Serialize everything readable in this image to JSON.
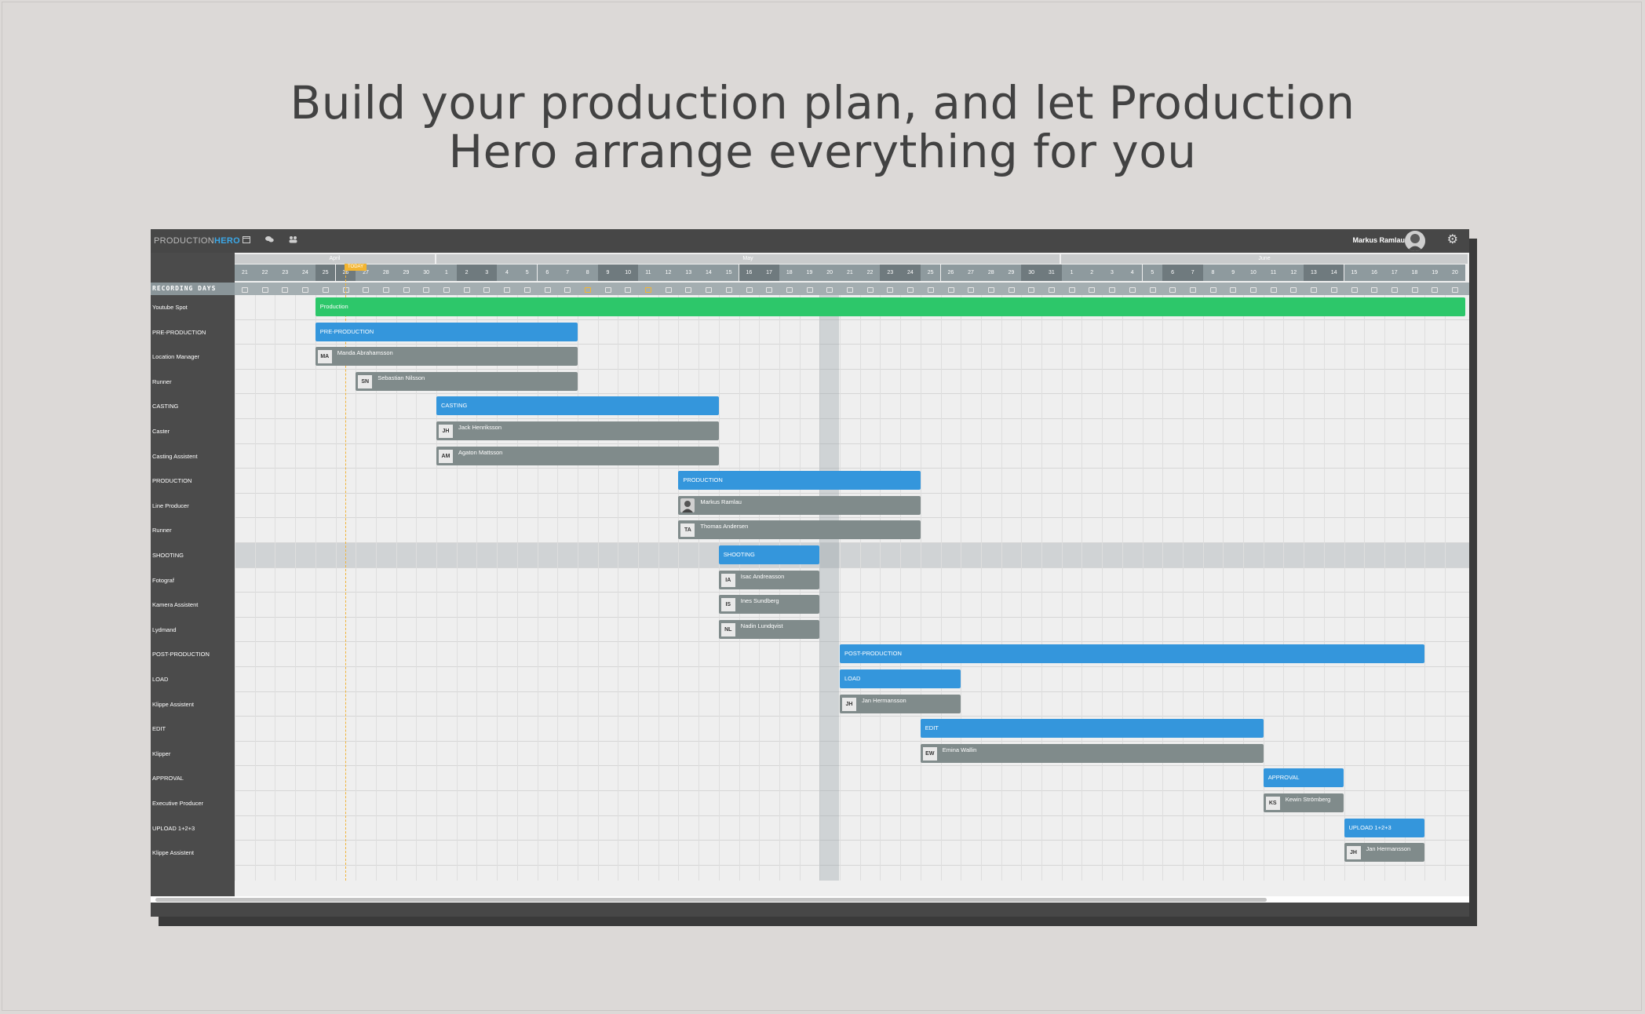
{
  "headline": {
    "line1": "Build your production plan, and let Production",
    "line2": "Hero arrange everything for you"
  },
  "app": {
    "logo_prefix": "PRODUCTION",
    "logo_suffix": "HERO",
    "toolbar_icons": [
      "calendar-icon",
      "chat-icon",
      "team-icon"
    ],
    "user_name": "Markus Ramlau",
    "accent_color": "#3ba8e8"
  },
  "calendar": {
    "months": [
      "April",
      "May",
      "June"
    ],
    "days": [
      "21",
      "22",
      "23",
      "24",
      "25",
      "26",
      "27",
      "28",
      "29",
      "30",
      "1",
      "2",
      "3",
      "4",
      "5",
      "6",
      "7",
      "8",
      "9",
      "10",
      "11",
      "12",
      "13",
      "14",
      "15",
      "16",
      "17",
      "18",
      "19",
      "20",
      "21",
      "22",
      "23",
      "24",
      "25",
      "26",
      "27",
      "28",
      "29",
      "30",
      "31",
      "1",
      "2",
      "3",
      "4",
      "5",
      "6",
      "7",
      "8",
      "9",
      "10",
      "11",
      "12",
      "13",
      "14",
      "15",
      "16",
      "17",
      "18",
      "19",
      "20"
    ],
    "today_label": "TODAY",
    "recording_days_label": "RECORDING DAYS"
  },
  "rows": [
    {
      "label": "Youtube Spot"
    },
    {
      "label": "PRE-PRODUCTION"
    },
    {
      "label": "Location Manager"
    },
    {
      "label": "Runner"
    },
    {
      "label": "CASTING"
    },
    {
      "label": "Caster"
    },
    {
      "label": "Casting Assistent"
    },
    {
      "label": "PRODUCTION"
    },
    {
      "label": "Line Producer"
    },
    {
      "label": "Runner"
    },
    {
      "label": "SHOOTING"
    },
    {
      "label": "Fotograf"
    },
    {
      "label": "Kamera Assistent"
    },
    {
      "label": "Lydmand"
    },
    {
      "label": "POST-PRODUCTION"
    },
    {
      "label": "LOAD"
    },
    {
      "label": "Klippe Assistent"
    },
    {
      "label": "EDIT"
    },
    {
      "label": "Klipper"
    },
    {
      "label": "APPROVAL"
    },
    {
      "label": "Executive Producer"
    },
    {
      "label": "UPLOAD 1+2+3"
    },
    {
      "label": "Klippe Assistent"
    }
  ],
  "bars": [
    {
      "type": "green",
      "label": "Production"
    },
    {
      "type": "blue",
      "label": "PRE-PRODUCTION"
    },
    {
      "type": "gray",
      "initials": "MA",
      "name": "Manda Abrahamsson"
    },
    {
      "type": "gray",
      "initials": "SN",
      "name": "Sebastian Nilsson"
    },
    {
      "type": "blue",
      "label": "CASTING"
    },
    {
      "type": "gray",
      "initials": "JH",
      "name": "Jack Henriksson"
    },
    {
      "type": "gray",
      "initials": "AM",
      "name": "Agaton Mattsson"
    },
    {
      "type": "blue",
      "label": "PRODUCTION"
    },
    {
      "type": "gray",
      "photo": true,
      "name": "Markus Ramlau"
    },
    {
      "type": "gray",
      "initials": "TA",
      "name": "Thomas Andersen"
    },
    {
      "type": "blue",
      "label": "SHOOTING"
    },
    {
      "type": "gray",
      "initials": "IA",
      "name": "Isac Andreasson"
    },
    {
      "type": "gray",
      "initials": "IS",
      "name": "Ines Sundberg"
    },
    {
      "type": "gray",
      "initials": "NL",
      "name": "Nadin Lundqvist"
    },
    {
      "type": "blue",
      "label": "POST-PRODUCTION"
    },
    {
      "type": "blue",
      "label": "LOAD"
    },
    {
      "type": "gray",
      "initials": "JH",
      "name": "Jan Hermansson"
    },
    {
      "type": "blue",
      "label": "EDIT"
    },
    {
      "type": "gray",
      "initials": "EW",
      "name": "Emina Wallin"
    },
    {
      "type": "blue",
      "label": "APPROVAL"
    },
    {
      "type": "gray",
      "initials": "KS",
      "name": "Kewin Strömberg"
    },
    {
      "type": "blue",
      "label": "UPLOAD 1+2+3"
    },
    {
      "type": "gray",
      "initials": "JH",
      "name": "Jan Hermansson"
    }
  ]
}
